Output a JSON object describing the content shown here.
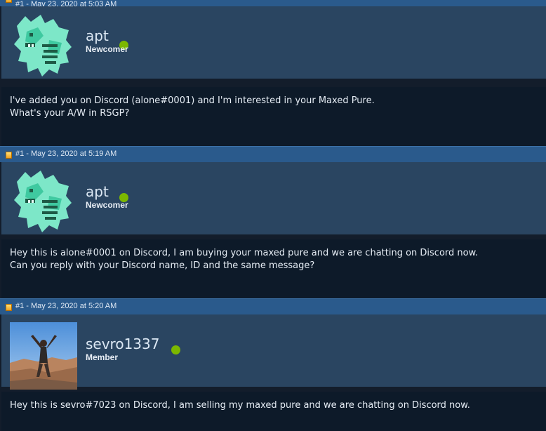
{
  "posts": [
    {
      "header": "#1 - May 23, 2020 at 5:03 AM",
      "username": "apt",
      "rank": "Newcomer",
      "avatar_icon": "arcanine-sprite-icon",
      "body": "I've added you on Discord (alone#0001) and I'm interested in your Maxed Pure.\nWhat's your A/W in RSGP?"
    },
    {
      "header": "#1 - May 23, 2020 at 5:19 AM",
      "username": "apt",
      "rank": "Newcomer",
      "avatar_icon": "arcanine-sprite-icon",
      "body": "Hey this is alone#0001 on Discord, I am buying your maxed pure and we are chatting on Discord now.\nCan you reply with your Discord name, ID and the same message?"
    },
    {
      "header": "#1 - May 23, 2020 at 5:20 AM",
      "username": "sevro1337",
      "rank": "Member",
      "avatar_icon": "person-photo-icon",
      "body": "Hey this is sevro#7023 on Discord, I am selling my maxed pure and we are chatting on Discord now."
    }
  ],
  "colors": {
    "header_bg": "#2a5a8c",
    "user_bg": "#2a4561",
    "body_bg": "#0d1a29",
    "online": "#7cb800"
  }
}
